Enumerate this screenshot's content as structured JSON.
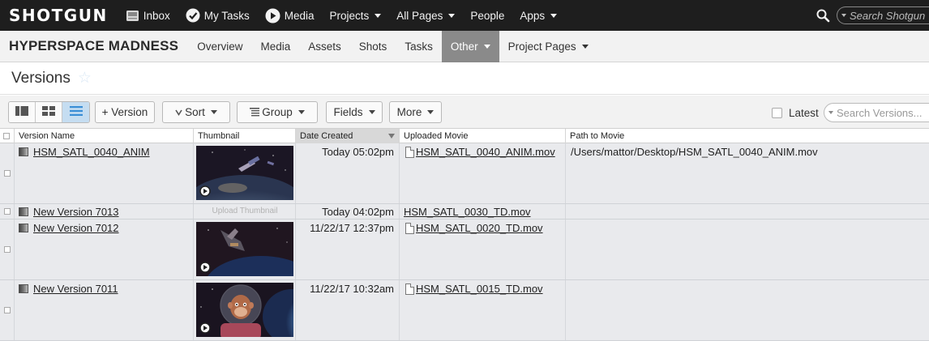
{
  "topbar": {
    "logo": "SHOTGUN",
    "nav": [
      {
        "label": "Inbox",
        "icon": "inbox-icon",
        "has_caret": false
      },
      {
        "label": "My Tasks",
        "icon": "check-circle-icon",
        "has_caret": false
      },
      {
        "label": "Media",
        "icon": "play-circle-icon",
        "has_caret": false
      },
      {
        "label": "Projects",
        "icon": "",
        "has_caret": true
      },
      {
        "label": "All Pages",
        "icon": "",
        "has_caret": true
      },
      {
        "label": "People",
        "icon": "",
        "has_caret": false
      },
      {
        "label": "Apps",
        "icon": "",
        "has_caret": true
      }
    ],
    "search_placeholder": "Search Shotgun"
  },
  "project": {
    "title": "HYPERSPACE MADNESS",
    "tabs": [
      {
        "label": "Overview",
        "active": false,
        "has_caret": false
      },
      {
        "label": "Media",
        "active": false,
        "has_caret": false
      },
      {
        "label": "Assets",
        "active": false,
        "has_caret": false
      },
      {
        "label": "Shots",
        "active": false,
        "has_caret": false
      },
      {
        "label": "Tasks",
        "active": false,
        "has_caret": false
      },
      {
        "label": "Other",
        "active": true,
        "has_caret": true
      },
      {
        "label": "Project Pages",
        "active": false,
        "has_caret": true
      }
    ]
  },
  "page": {
    "title": "Versions"
  },
  "toolbar": {
    "add_version": "+ Version",
    "sort": "Sort",
    "group": "Group",
    "fields": "Fields",
    "more": "More",
    "latest": "Latest",
    "search_placeholder": "Search Versions..."
  },
  "grid": {
    "columns": [
      "Version Name",
      "Thumbnail",
      "Date Created",
      "Uploaded Movie",
      "Path to Movie"
    ],
    "sorted_column": "Date Created",
    "sort_direction": "descending",
    "rows": [
      {
        "name": "HSM_SATL_0040_ANIM",
        "thumbnail": "space-satellite-earth",
        "date": "Today 05:02pm",
        "movie": "HSM_SATL_0040_ANIM.mov",
        "movie_icon": true,
        "path": "/Users/mattor/Desktop/HSM_SATL_0040_ANIM.mov"
      },
      {
        "name": "New Version 7013",
        "thumbnail": "",
        "upload_label": "Upload Thumbnail",
        "date": "Today 04:02pm",
        "movie": "HSM_SATL_0030_TD.mov",
        "movie_icon": false,
        "path": ""
      },
      {
        "name": "New Version 7012",
        "thumbnail": "space-station-earth",
        "date": "11/22/17 12:37pm",
        "movie": "HSM_SATL_0020_TD.mov",
        "movie_icon": true,
        "path": ""
      },
      {
        "name": "New Version 7011",
        "thumbnail": "monkey-astronaut",
        "date": "11/22/17 10:32am",
        "movie": "HSM_SATL_0015_TD.mov",
        "movie_icon": true,
        "path": ""
      }
    ]
  },
  "colors": {
    "topbar_bg": "#1e1e1e",
    "active_tab_bg": "#8a8a8a",
    "row_bg": "#e9eaed",
    "active_view_bg": "#c5ddf1",
    "list_icon_blue": "#3a8ed6"
  }
}
